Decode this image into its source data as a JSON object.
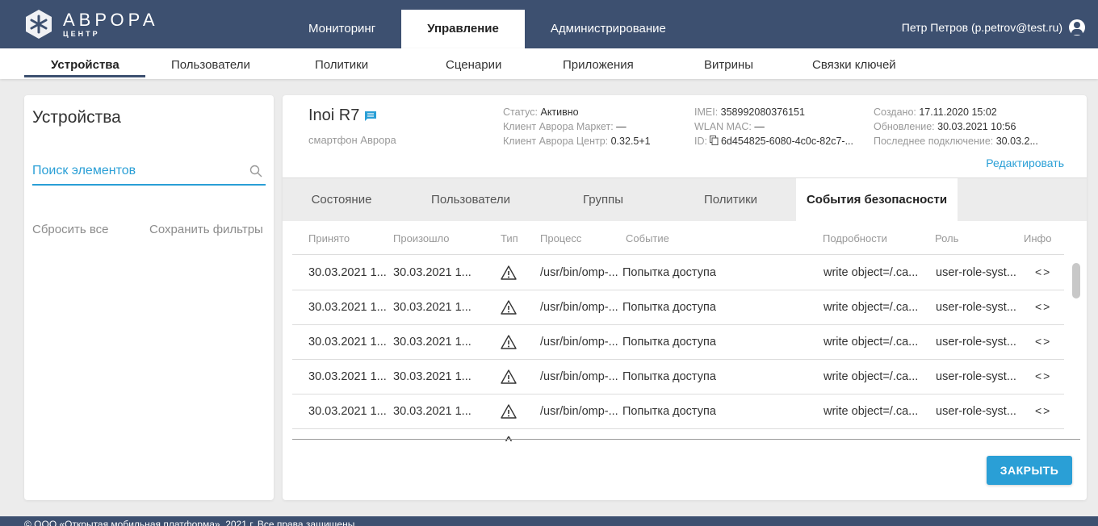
{
  "logo": {
    "title": "АВРОРА",
    "subtitle": "ЦЕНТР"
  },
  "topnav": [
    {
      "label": "Мониторинг"
    },
    {
      "label": "Управление"
    },
    {
      "label": "Администрирование"
    }
  ],
  "user": {
    "name": "Петр Петров (p.petrov@test.ru)"
  },
  "subnav": [
    {
      "label": "Устройства"
    },
    {
      "label": "Пользователи"
    },
    {
      "label": "Политики"
    },
    {
      "label": "Сценарии"
    },
    {
      "label": "Приложения"
    },
    {
      "label": "Витрины"
    },
    {
      "label": "Связки ключей"
    }
  ],
  "sidebar": {
    "title": "Устройства",
    "search_placeholder": "Поиск элементов",
    "reset_label": "Сбросить все",
    "save_label": "Сохранить фильтры"
  },
  "device": {
    "name": "Inoi R7",
    "type": "смартфон Аврора",
    "status_label": "Статус:",
    "status_value": "Активно",
    "market_label": "Клиент Аврора Маркет:",
    "market_value": "—",
    "center_label": "Клиент Аврора Центр:",
    "center_value": "0.32.5+1",
    "imei_label": "IMEI:",
    "imei_value": "358992080376151",
    "mac_label": "WLAN MAC:",
    "mac_value": "—",
    "id_label": "ID:",
    "id_value": "6d454825-6080-4c0c-82c7-...",
    "created_label": "Создано:",
    "created_value": "17.11.2020 15:02",
    "updated_label": "Обновление:",
    "updated_value": "30.03.2021 10:56",
    "last_conn_label": "Последнее подключение:",
    "last_conn_value": "30.03.2...",
    "edit_label": "Редактировать"
  },
  "tabs": [
    {
      "label": "Состояние"
    },
    {
      "label": "Пользователи"
    },
    {
      "label": "Группы"
    },
    {
      "label": "Политики"
    },
    {
      "label": "События безопасности"
    }
  ],
  "table": {
    "headers": {
      "received": "Принято",
      "occurred": "Произошло",
      "type": "Тип",
      "process": "Процесс",
      "event": "Событие",
      "details": "Подробности",
      "role": "Роль",
      "info": "Инфо"
    },
    "rows": [
      {
        "received": "30.03.2021 1...",
        "occurred": "30.03.2021 1...",
        "type_icon": "warning-icon",
        "process": "/usr/bin/omp-...",
        "event": "Попытка доступа",
        "details": "write object=/.ca...",
        "role": "user-role-syst...",
        "info": "<>"
      },
      {
        "received": "30.03.2021 1...",
        "occurred": "30.03.2021 1...",
        "type_icon": "warning-icon",
        "process": "/usr/bin/omp-...",
        "event": "Попытка доступа",
        "details": "write object=/.ca...",
        "role": "user-role-syst...",
        "info": "<>"
      },
      {
        "received": "30.03.2021 1...",
        "occurred": "30.03.2021 1...",
        "type_icon": "warning-icon",
        "process": "/usr/bin/omp-...",
        "event": "Попытка доступа",
        "details": "write object=/.ca...",
        "role": "user-role-syst...",
        "info": "<>"
      },
      {
        "received": "30.03.2021 1...",
        "occurred": "30.03.2021 1...",
        "type_icon": "warning-icon",
        "process": "/usr/bin/omp-...",
        "event": "Попытка доступа",
        "details": "write object=/.ca...",
        "role": "user-role-syst...",
        "info": "<>"
      },
      {
        "received": "30.03.2021 1...",
        "occurred": "30.03.2021 1...",
        "type_icon": "warning-icon",
        "process": "/usr/bin/omp-...",
        "event": "Попытка доступа",
        "details": "write object=/.ca...",
        "role": "user-role-syst...",
        "info": "<>"
      }
    ]
  },
  "close_label": "ЗАКРЫТЬ",
  "footer": {
    "text": "© ООО «Открытая мобильная платформа», 2021 г. Все права защищены"
  },
  "colors": {
    "header": "#3d5070",
    "accent": "#2a9fd6"
  }
}
